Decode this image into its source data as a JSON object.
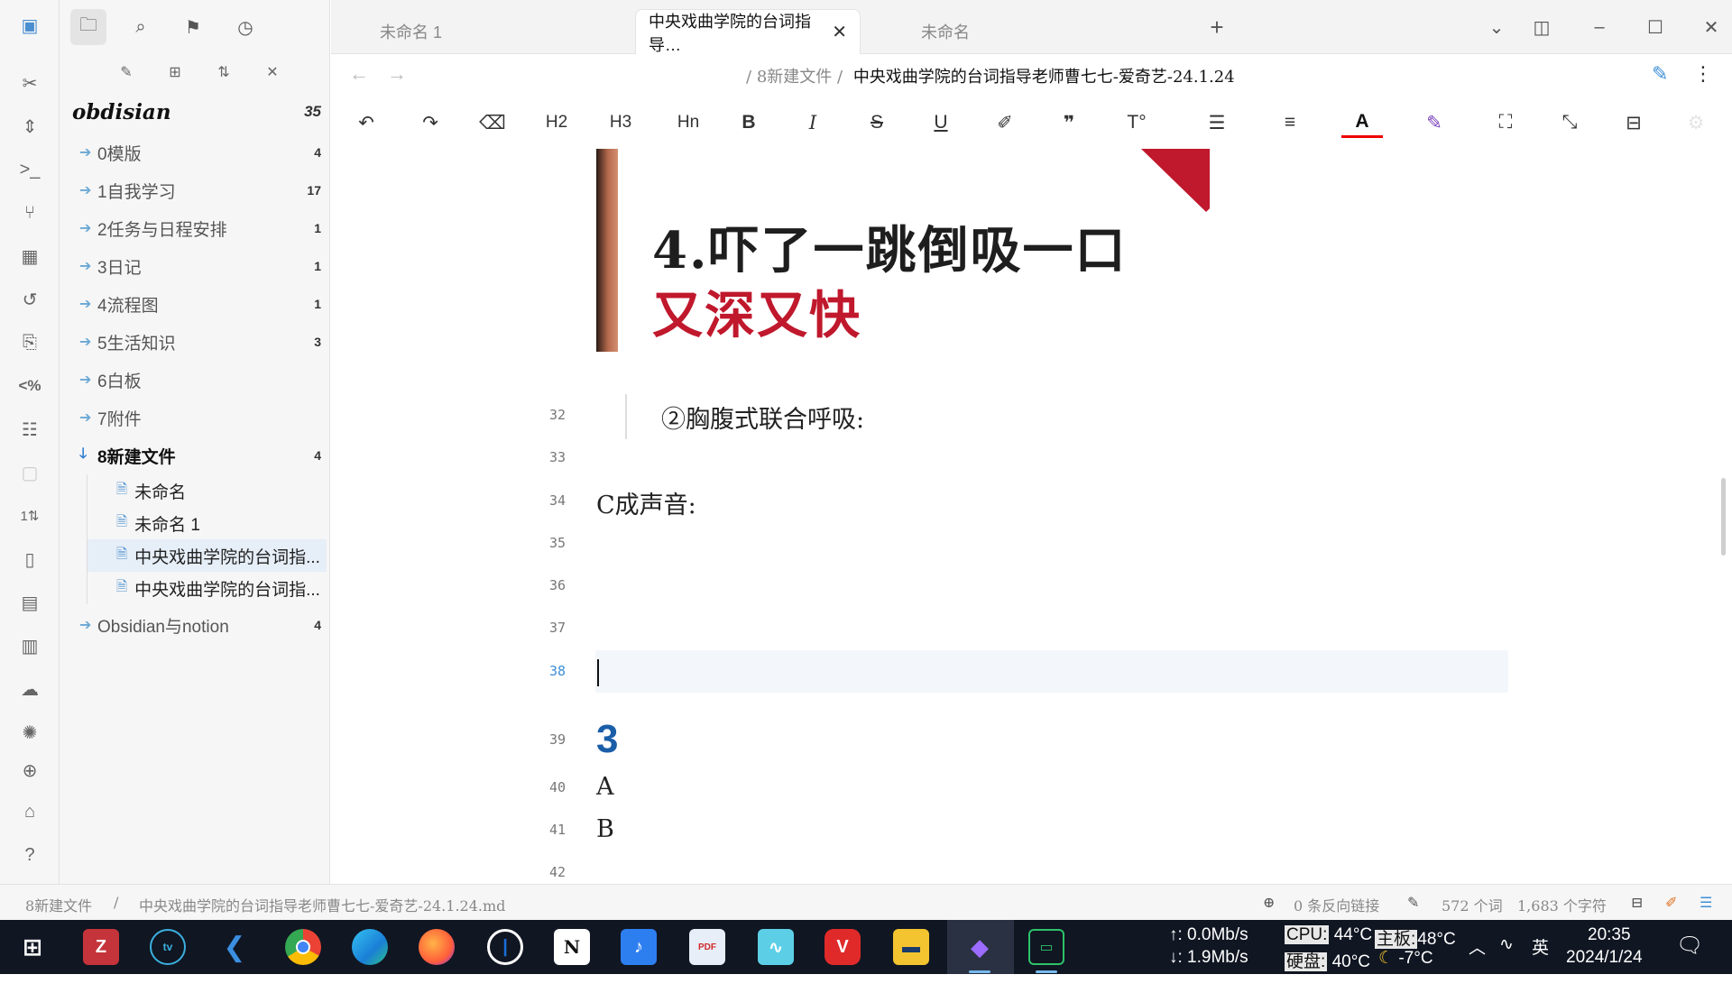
{
  "tabs": [
    {
      "label": "未命名 1"
    },
    {
      "label": "中央戏曲学院的台词指导…"
    },
    {
      "label": "未命名"
    }
  ],
  "breadcrumb": {
    "folder": "8新建文件",
    "separator": "/",
    "note": "中央戏曲学院的台词指导老师曹七七-爱奇艺-24.1.24"
  },
  "sidebar": {
    "vault_name": "obdisian",
    "vault_count": "35",
    "folders": [
      {
        "label": "0模版",
        "count": "4"
      },
      {
        "label": "1自我学习",
        "count": "17"
      },
      {
        "label": "2任务与日程安排",
        "count": "1"
      },
      {
        "label": "3日记",
        "count": "1"
      },
      {
        "label": "4流程图",
        "count": "1"
      },
      {
        "label": "5生活知识",
        "count": "3"
      },
      {
        "label": "6白板",
        "count": ""
      },
      {
        "label": "7附件",
        "count": ""
      },
      {
        "label": "8新建文件",
        "count": "4"
      }
    ],
    "files": [
      {
        "label": "未命名"
      },
      {
        "label": "未命名 1"
      },
      {
        "label": "中央戏曲学院的台词指..."
      },
      {
        "label": "中央戏曲学院的台词指..."
      }
    ],
    "extra_folder": {
      "label": "Obsidian与notion",
      "count": "4"
    }
  },
  "toolbar": {
    "h2": "H2",
    "h3": "H3",
    "hn": "Hn",
    "bold": "B",
    "italic": "I",
    "strike": "S",
    "underline": "U",
    "color_a": "A"
  },
  "editor": {
    "image_line1": "4.吓了一跳倒吸一口",
    "image_line2": "又深又快",
    "lines": [
      {
        "num": "32",
        "text": "②胸腹式联合呼吸:"
      },
      {
        "num": "33",
        "text": ""
      },
      {
        "num": "34",
        "text": "C成声音:"
      },
      {
        "num": "35",
        "text": ""
      },
      {
        "num": "36",
        "text": ""
      },
      {
        "num": "37",
        "text": ""
      },
      {
        "num": "38",
        "text": ""
      },
      {
        "num": "39",
        "text": "3"
      },
      {
        "num": "40",
        "text": "A"
      },
      {
        "num": "41",
        "text": "B"
      },
      {
        "num": "42",
        "text": ""
      }
    ]
  },
  "status": {
    "folder": "8新建文件",
    "sep": "/",
    "file": "中央戏曲学院的台词指导老师曹七七-爱奇艺-24.1.24.md",
    "backlinks": "0 条反向链接",
    "words": "572 个词",
    "chars": "1,683 个字符"
  },
  "taskbar": {
    "net_up": "↑: 0.0Mb/s",
    "net_down": "↓: 1.9Mb/s",
    "cpu_label": "CPU:",
    "cpu_val": "44°C",
    "board_label": "主板:",
    "board_val": "48°C",
    "disk_label": "硬盘:",
    "disk_val": "40°C",
    "weather": "-7°C",
    "ime": "英",
    "time": "20:35",
    "date": "2024/1/24"
  },
  "colors": {
    "accent": "#3d8fd8",
    "heading_blue": "#1a5ea8",
    "red": "#c0182c"
  },
  "icons": [
    "sidebar-toggle-icon",
    "folder-icon",
    "search-icon",
    "bookmark-icon",
    "clock-icon",
    "new-note-icon",
    "new-folder-icon",
    "sort-icon",
    "collapse-icon",
    "undo-icon",
    "redo-icon",
    "eraser-icon",
    "quote-icon",
    "list-icon",
    "align-icon",
    "highlight-icon",
    "fullscreen-icon",
    "exit-fullscreen-icon",
    "edit-icon",
    "more-icon"
  ]
}
